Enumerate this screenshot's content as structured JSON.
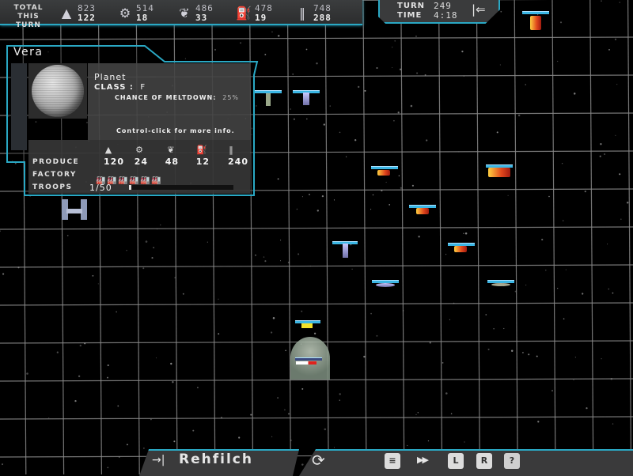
{
  "topbar": {
    "total_label": "TOTAL",
    "this_turn_label": "THIS TURN",
    "resources": [
      {
        "name": "minerals",
        "icon": "gold-bars-icon",
        "total": "823",
        "this_turn": "122"
      },
      {
        "name": "gears",
        "icon": "gear-icon",
        "total": "514",
        "this_turn": "18"
      },
      {
        "name": "organics",
        "icon": "leaf-icon",
        "total": "486",
        "this_turn": "33"
      },
      {
        "name": "fuel",
        "icon": "fuel-pump-icon",
        "total": "478",
        "this_turn": "19"
      },
      {
        "name": "troops",
        "icon": "soldiers-icon",
        "total": "748",
        "this_turn": "288"
      }
    ]
  },
  "turnbox": {
    "turn_label": "TURN",
    "turn_value": "249",
    "time_label": "TIME",
    "time_value": "4:18",
    "back_icon": "back-arrow-icon"
  },
  "panel": {
    "title": "Vera",
    "type": "Planet",
    "class_label": "CLASS :",
    "class_value": "F",
    "meltdown_label": "CHANCE OF MELTDOWN:",
    "meltdown_value": "25%",
    "hint": "Control-click for more info.",
    "produce_label": "PRODUCE",
    "factory_label": "FACTORY",
    "troops_label": "TROOPS",
    "produce": [
      {
        "icon": "gold-bars-icon",
        "value": "120"
      },
      {
        "icon": "gear-icon",
        "value": "24"
      },
      {
        "icon": "leaf-icon",
        "value": "48"
      },
      {
        "icon": "fuel-pump-icon",
        "value": "12"
      },
      {
        "icon": "soldiers-icon",
        "value": "240"
      }
    ],
    "factories": {
      "active": 4,
      "damaged": 2
    },
    "troops_value": "1/50",
    "troops_fraction": 0.02
  },
  "bottombar": {
    "end_turn_icon": "end-turn-icon",
    "player_name": "Rehfilch",
    "cycle_icon": "cycle-icon",
    "buttons": [
      {
        "name": "menu-button",
        "icon": "list-icon",
        "glyph": "≡"
      },
      {
        "name": "fast-forward-button",
        "icon": "fast-forward-ship-icon",
        "glyph": "▶▶"
      },
      {
        "name": "log-button",
        "icon": "log-icon",
        "glyph": "L"
      },
      {
        "name": "research-button",
        "icon": "research-icon",
        "glyph": "R"
      },
      {
        "name": "help-button",
        "icon": "help-icon",
        "glyph": "?"
      }
    ]
  },
  "colors": {
    "accent": "#2aa8c4",
    "panel": "#3a3a3b",
    "enemy": "#e0461c",
    "damaged_factory": "#e0221c"
  }
}
